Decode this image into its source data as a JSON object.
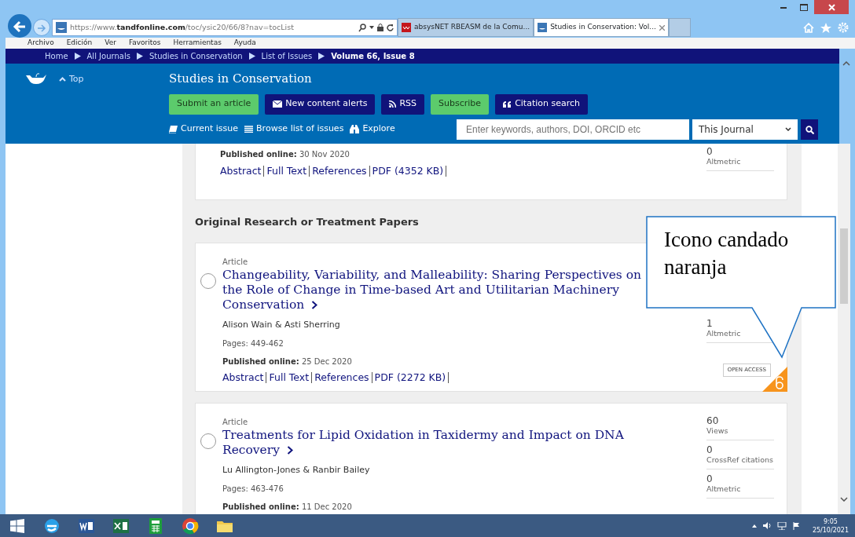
{
  "browser": {
    "address": "https://www.**tandfonline.com**/toc/ysic20/66/8?nav=tocList",
    "tabs": [
      {
        "label": "absysNET RBEASM de la Comu...",
        "selected": false
      },
      {
        "label": "Studies in Conservation: Vol...",
        "selected": true
      }
    ],
    "menu": [
      "Archivo",
      "Edición",
      "Ver",
      "Favoritos",
      "Herramientas",
      "Ayuda"
    ]
  },
  "breadcrumb": [
    "Home",
    "All Journals",
    "Studies in Conservation",
    "List of Issues",
    "Volume 66, Issue 8"
  ],
  "header": {
    "top_link": "Top",
    "journal_title": "Studies in Conservation",
    "actions": [
      {
        "label": "Submit an article",
        "kind": "submit"
      },
      {
        "label": "New content alerts",
        "kind": "alerts"
      },
      {
        "label": "RSS",
        "kind": "rss"
      },
      {
        "label": "Subscribe",
        "kind": "subscribe"
      },
      {
        "label": "Citation search",
        "kind": "citation"
      }
    ],
    "nav_links": [
      {
        "label": "Current issue",
        "kind": "current"
      },
      {
        "label": "Browse list of issues",
        "kind": "browse"
      },
      {
        "label": "Explore",
        "kind": "explore"
      }
    ],
    "search": {
      "placeholder": "Enter keywords, authors, DOI, ORCID etc",
      "scope": "This Journal"
    }
  },
  "previous_article": {
    "published": "**Published online:** 30 Nov 2020",
    "links": [
      "Abstract",
      "Full Text",
      "References",
      "PDF (4352 KB)"
    ],
    "metrics": [
      {
        "value": "0",
        "label": "Altmetric"
      }
    ]
  },
  "section_heading": "Original Research or Treatment Papers",
  "articles": [
    {
      "selected": false,
      "type": "Article",
      "title": "Changeability, Variability, and Malleability: Sharing Perspectives on the Role of Change in Time-based Art and Utilitarian Machinery Conservation",
      "authors": "Alison Wain & Asti Sherring",
      "pages": "Pages: 449-462",
      "published": "**Published online:** 25 Dec 2020",
      "links": [
        "Abstract",
        "Full Text",
        "References",
        "PDF (2272 KB)"
      ],
      "metrics": [
        {
          "value": "1",
          "label": "Altmetric"
        }
      ],
      "open_access": true,
      "access_label": "OPEN ACCESS"
    },
    {
      "selected": false,
      "type": "Article",
      "title": "Treatments for Lipid Oxidation in Taxidermy and Impact on DNA Recovery",
      "authors": "Lu Allington-Jones & Ranbir Bailey",
      "pages": "Pages: 463-476",
      "published": "**Published online:** 11 Dec 2020",
      "metrics": [
        {
          "value": "60",
          "label": "Views"
        },
        {
          "value": "0",
          "label": "CrossRef citations"
        },
        {
          "value": "0",
          "label": "Altmetric"
        }
      ],
      "open_access": false
    }
  ],
  "callout": {
    "text": "Icono candado naranja"
  },
  "taskbar": {
    "time": "9:05",
    "date": "25/10/2021"
  }
}
